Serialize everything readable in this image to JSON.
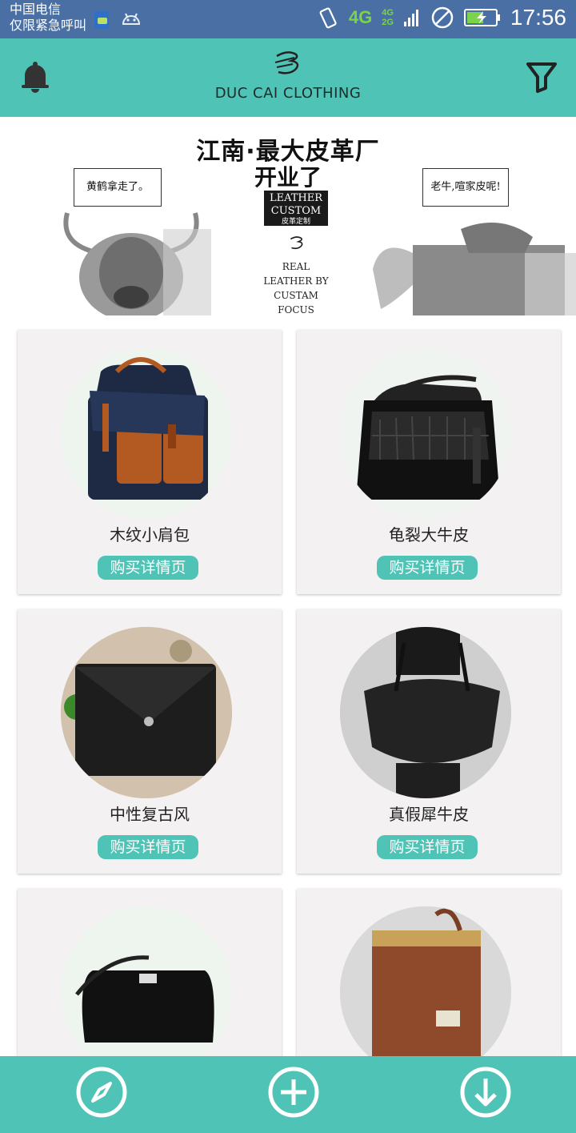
{
  "status_bar": {
    "carrier": "中国电信",
    "emergency_text": "仅限紧急呼叫",
    "network_4g": "4G",
    "network_small_4g": "4G",
    "network_small_2g": "2G",
    "time": "17:56",
    "icons": [
      "sim-chat-icon",
      "android-icon",
      "rotate-icon",
      "signal-icon",
      "no-disturb-icon",
      "battery-icon"
    ]
  },
  "header": {
    "brand": "DUC CAI CLOTHING",
    "left_icon": "bell-icon",
    "right_icon": "filter-icon",
    "accent": "#4fc3b6"
  },
  "banner": {
    "title": "江南·最大皮革厂",
    "subtitle": "开业了",
    "badge_line1": "LEATHER",
    "badge_line2": "CUSTOM",
    "badge_cn": "皮革定制",
    "text_line1": "REAL",
    "text_line2": "LEATHER BY CUSTAM",
    "text_line3": "FOCUS",
    "bubble_left": "黄鹤拿走了。",
    "bubble_right": "老牛,喧家皮呢!"
  },
  "products": [
    {
      "title": "木纹小肩包",
      "buy_label": "购买详情页"
    },
    {
      "title": "龟裂大牛皮",
      "buy_label": "购买详情页"
    },
    {
      "title": "中性复古风",
      "buy_label": "购买详情页"
    },
    {
      "title": "真假犀牛皮",
      "buy_label": "购买详情页"
    },
    {
      "title": "",
      "buy_label": ""
    },
    {
      "title": "",
      "buy_label": ""
    }
  ],
  "bottom_nav": {
    "items": [
      "compass-icon",
      "plus-icon",
      "download-icon"
    ]
  }
}
